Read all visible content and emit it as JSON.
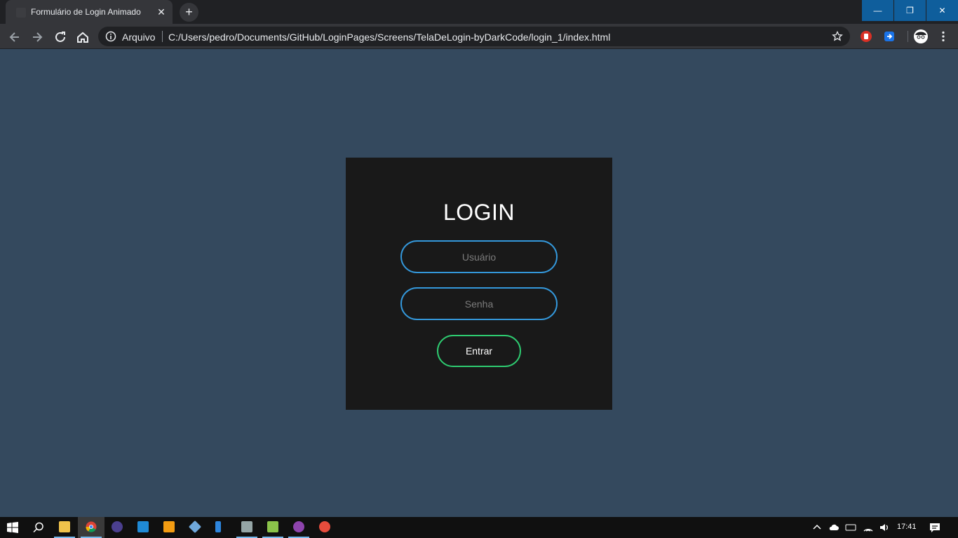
{
  "browser": {
    "tab": {
      "title": "Formulário de Login Animado",
      "close_glyph": "✕"
    },
    "new_tab_glyph": "+",
    "window_controls": {
      "minimize": "—",
      "restore": "❐",
      "close": "✕"
    },
    "omnibox": {
      "scheme_label": "Arquivo",
      "url": "C:/Users/pedro/Documents/GitHub/LoginPages/Screens/TelaDeLogin-byDarkCode/login_1/index.html"
    },
    "extensions": [
      "red-extension-icon",
      "blue-extension-icon",
      "profile-avatar-icon"
    ]
  },
  "page": {
    "background_color": "#34495e",
    "box_color": "#191919",
    "title": "LOGIN",
    "username_placeholder": "Usuário",
    "password_placeholder": "Senha",
    "submit_label": "Entrar",
    "input_border_color": "#3498db",
    "button_border_color": "#2ecc71"
  },
  "taskbar": {
    "pinned": [
      "file-explorer-icon",
      "chrome-icon",
      "terminal-icon",
      "vscode-icon",
      "sublime-text-icon",
      "app-icon",
      "app-icon",
      "app-icon",
      "app-icon",
      "app-icon",
      "app-icon"
    ],
    "clock": "17:41"
  }
}
